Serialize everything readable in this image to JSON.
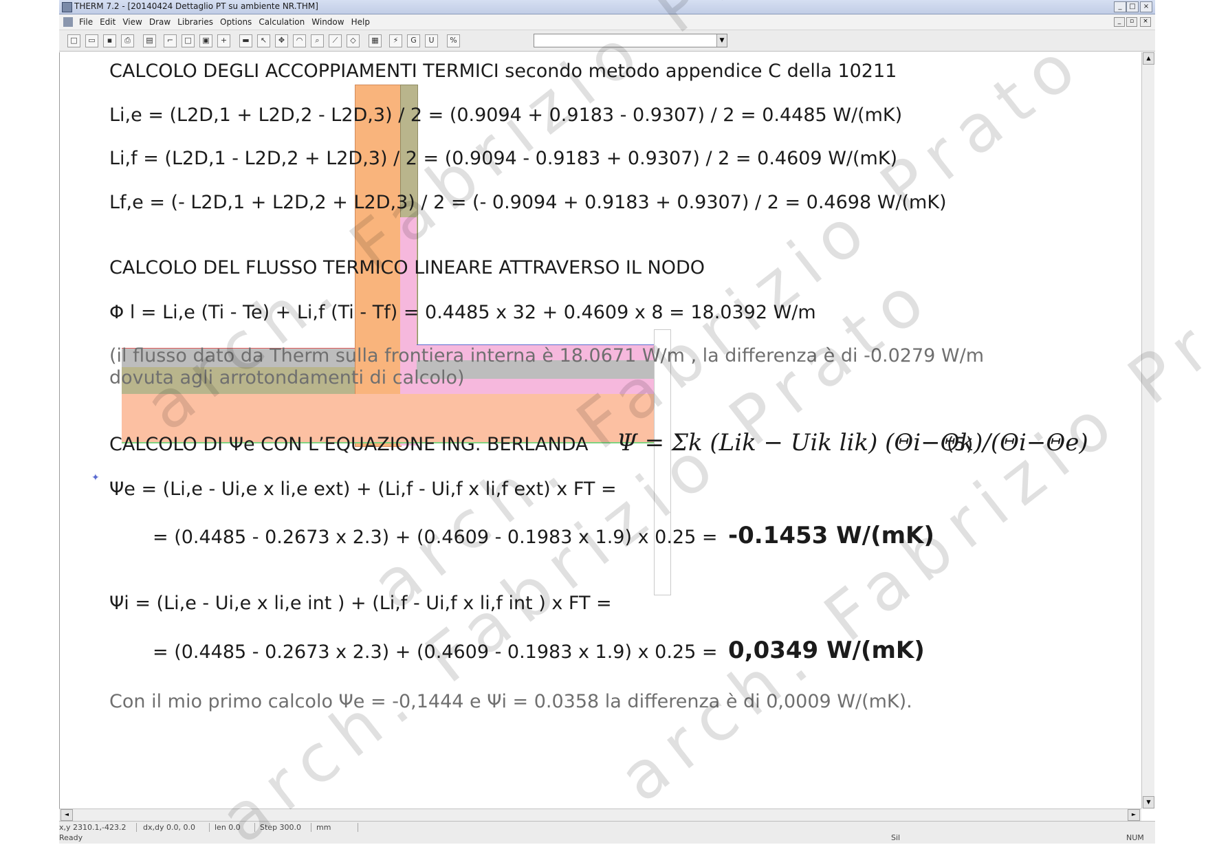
{
  "window": {
    "title": "THERM 7.2 - [20140424 Dettaglio PT su ambiente NR.THM]",
    "controls": [
      "_",
      "□",
      "×"
    ]
  },
  "menu": {
    "items": [
      "File",
      "Edit",
      "View",
      "Draw",
      "Libraries",
      "Options",
      "Calculation",
      "Window",
      "Help"
    ]
  },
  "toolbar": {
    "icons": [
      "new-icon",
      "open-icon",
      "save-icon",
      "print-icon",
      "library-icon",
      "polygon-icon",
      "rectangle-icon",
      "fill-icon",
      "locate-icon",
      "boundary-icon",
      "select-icon",
      "pan-icon",
      "zoom-icon",
      "ruler-icon",
      "calculate-icon",
      "results-icon",
      "units-icon",
      "toggle-icon"
    ],
    "combo_value": ""
  },
  "content": {
    "heading1": "CALCOLO DEGLI ACCOPPIAMENTI TERMICI secondo metodo appendice C  della 10211",
    "eq1": "Li,e = (L2D,1 + L2D,2 - L2D,3) / 2 = (0.9094 + 0.9183 - 0.9307) / 2 = 0.4485 W/(mK)",
    "eq2": "Li,f = (L2D,1 - L2D,2 + L2D,3) / 2 = (0.9094 - 0.9183 + 0.9307) / 2 = 0.4609 W/(mK)",
    "eq3": "Lf,e = (- L2D,1 + L2D,2 + L2D,3) / 2 = (- 0.9094 + 0.9183 + 0.9307) / 2 = 0.4698 W/(mK)",
    "heading2": "CALCOLO DEL FLUSSO TERMICO LINEARE ATTRAVERSO IL NODO",
    "eq4": "Φ l  = Li,e (Ti - Te) + Li,f (Ti - Tf) = 0.4485 x 32 + 0.4609 x 8 = 18.0392 W/m",
    "note1": "(il flusso dato da Therm sulla frontiera interna è 18.0671 W/m , la differenza è di -0.0279 W/m",
    "note2": "dovuta agli arrotondamenti di calcolo)",
    "heading3": "CALCOLO DI Ψe  CON L’EQUAZIONE ING. BERLANDA",
    "formula": "Ψ = Σk (Lik − Uik lik) (Θi−Θk)/(Θi−Θe)",
    "formula_num": "(5)",
    "psie_def": "Ψe  = (Li,e - Ui,e x li,e ext) + (Li,f - Ui,f x li,f ext) x FT =",
    "psie_calc": "= (0.4485 - 0.2673 x 2.3) + (0.4609 - 0.1983 x 1.9) x 0.25 =",
    "psie_result": "-0.1453 W/(mK)",
    "psii_def": "Ψi  = (Li,e - Ui,e x li,e int ) + (Li,f - Ui,f x li,f int ) x FT =",
    "psii_calc": "= (0.4485 - 0.2673 x 2.3) + (0.4609 - 0.1983 x 1.9) x 0.25 =",
    "psii_result": "0,0349 W/(mK)",
    "footer": "Con il mio primo calcolo Ψe  = -0,1444 e Ψi  = 0.0358 la differenza è di 0,0009 W/(mK)."
  },
  "watermark": [
    "arch. Fabrizio Prato",
    "arch. Fabrizio Prato",
    "arch. Fabrizio Prato",
    "arch. Fabrizio Prato"
  ],
  "status": {
    "coords": "x,y 2310.1,-423.2",
    "delta": "dx,dy  0.0, 0.0",
    "len": "len  0.0",
    "step": "Step 300.0",
    "units": "mm",
    "ready": "Ready",
    "sil": "Sil",
    "num": "NUM"
  },
  "colors": {
    "orange": "#f9b47c",
    "olive": "#b9b58c",
    "pink": "#f6b8dd",
    "salmon": "#fcc0a2",
    "gray": "#bdbdbd",
    "outline": "#5a6bd0"
  }
}
